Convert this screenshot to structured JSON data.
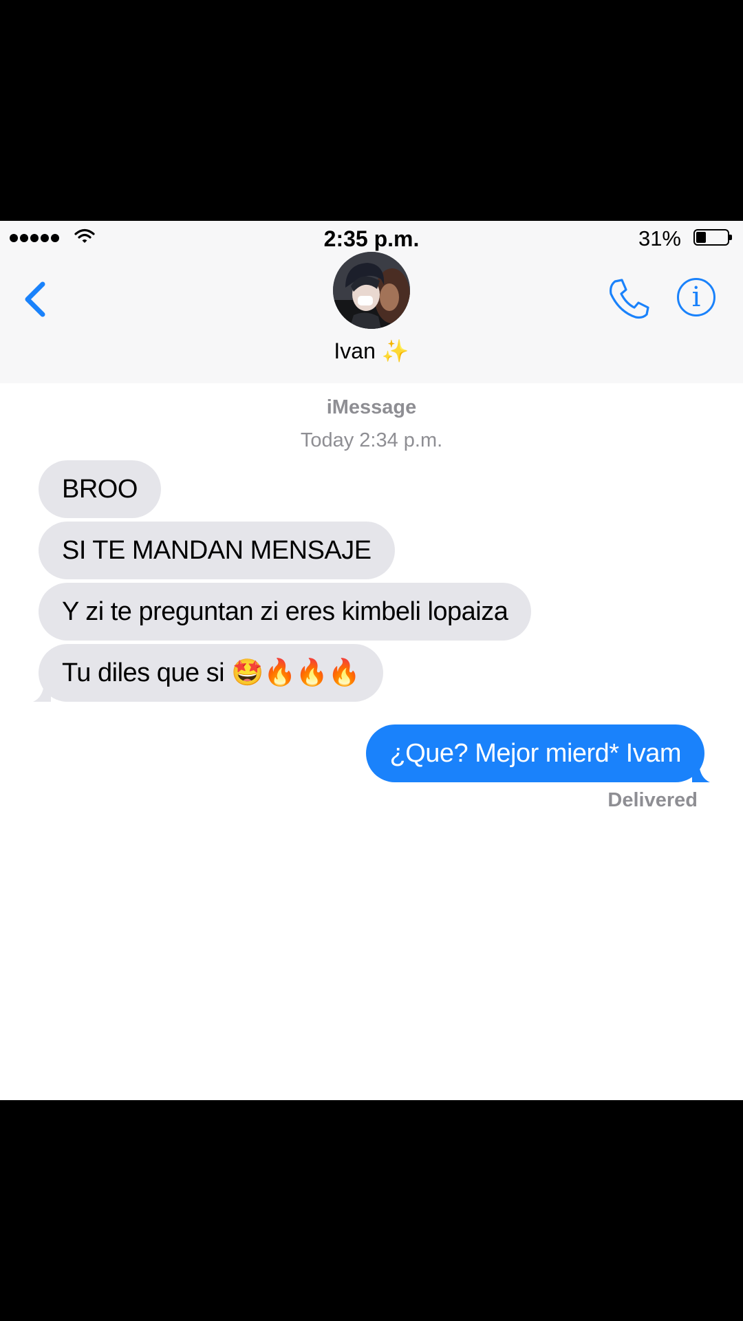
{
  "status_bar": {
    "time": "2:35 p.m.",
    "battery_percent": "31%",
    "battery_level": 0.31,
    "signal_dots": 5,
    "wifi_icon": "wifi-icon"
  },
  "header": {
    "back_icon": "chevron-left-icon",
    "contact_name": "Ivan ✨",
    "phone_icon": "phone-icon",
    "info_icon": "info-icon",
    "info_glyph": "i"
  },
  "thread": {
    "service": "iMessage",
    "timestamp": "Today 2:34 p.m.",
    "incoming": [
      {
        "text": "BROO"
      },
      {
        "text": "SI TE MANDAN MENSAJE"
      },
      {
        "text": "Y zi te preguntan zi eres kimbeli lopaiza"
      },
      {
        "text": "Tu diles que si 🤩🔥🔥🔥"
      }
    ],
    "outgoing": [
      {
        "text": "¿Que? Mejor mierd* Ivam",
        "status": "Delivered"
      }
    ]
  },
  "colors": {
    "accent": "#1a82fb",
    "incoming_bubble": "#e5e5ea",
    "meta_text": "#8e8e93",
    "header_bg": "#f7f7f8"
  }
}
